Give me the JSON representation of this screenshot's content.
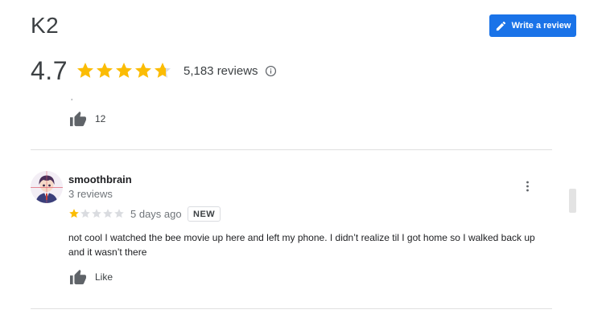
{
  "place": {
    "title": "K2"
  },
  "header": {
    "write_review_label": "Write a review"
  },
  "rating": {
    "value": "4.7",
    "stars": 4.7,
    "review_count": "5,183 reviews"
  },
  "previous_review": {
    "stray_text": "¸",
    "likes": "12"
  },
  "review": {
    "author": "smoothbrain",
    "author_meta": "3 reviews",
    "stars": 1,
    "date": "5 days ago",
    "badge": "NEW",
    "text": "not cool I watched the bee movie up here and left my phone. I didn’t realize til I got home so I walked back up and it wasn’t there",
    "like_label": "Like"
  },
  "colors": {
    "accent": "#1a73e8",
    "star_filled": "#fbbc04",
    "star_empty": "#dadce0"
  },
  "icons": {
    "write": "pencil-icon",
    "info": "info-icon",
    "like": "thumbs-up-icon",
    "more": "more-vert-icon"
  }
}
